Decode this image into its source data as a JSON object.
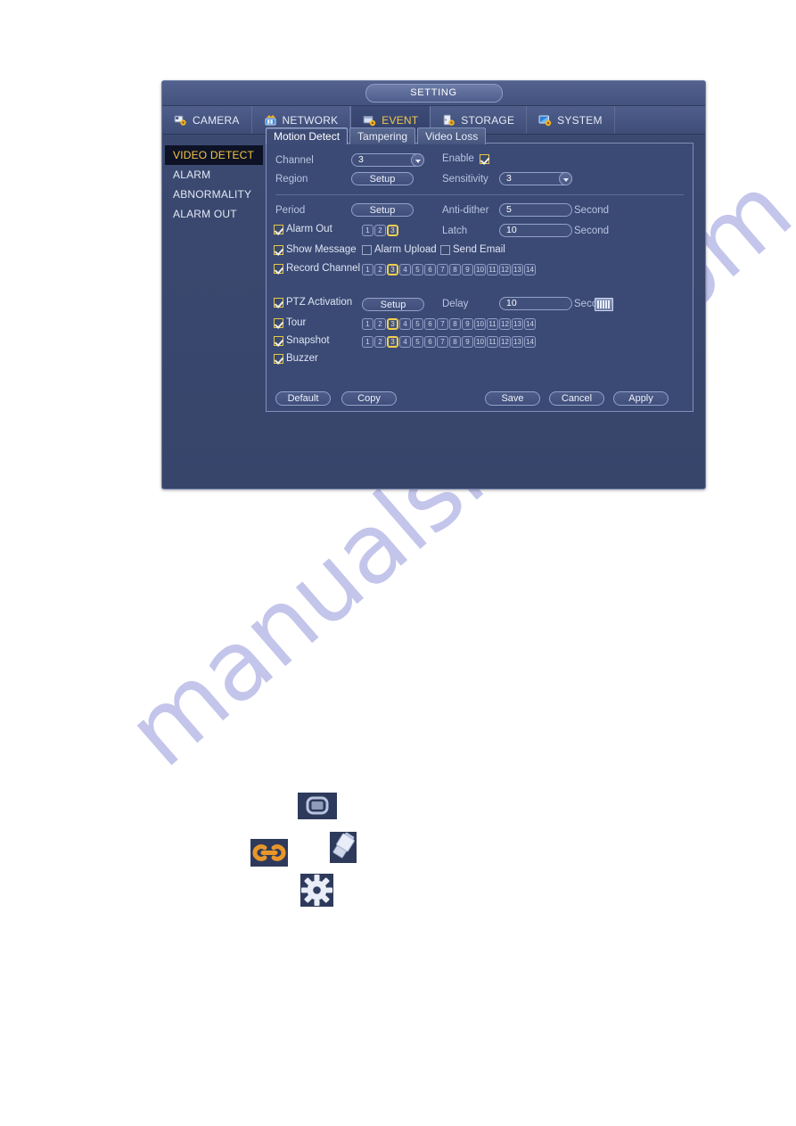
{
  "window": {
    "title": "SETTING",
    "menu": [
      {
        "label": "CAMERA",
        "icon": "camera-gear-icon",
        "active": false
      },
      {
        "label": "NETWORK",
        "icon": "network-icon",
        "active": false
      },
      {
        "label": "EVENT",
        "icon": "event-gear-icon",
        "active": true
      },
      {
        "label": "STORAGE",
        "icon": "storage-gear-icon",
        "active": false
      },
      {
        "label": "SYSTEM",
        "icon": "system-gear-icon",
        "active": false
      }
    ]
  },
  "sidebar": {
    "items": [
      {
        "label": "VIDEO DETECT",
        "active": true
      },
      {
        "label": "ALARM",
        "active": false
      },
      {
        "label": "ABNORMALITY",
        "active": false
      },
      {
        "label": "ALARM OUT",
        "active": false
      }
    ]
  },
  "tabs": [
    {
      "label": "Motion Detect",
      "active": true
    },
    {
      "label": "Tampering",
      "active": false
    },
    {
      "label": "Video Loss",
      "active": false
    }
  ],
  "form": {
    "channel_label": "Channel",
    "channel_value": "3",
    "enable_label": "Enable",
    "enable_checked": true,
    "region_label": "Region",
    "region_button": "Setup",
    "sensitivity_label": "Sensitivity",
    "sensitivity_value": "3",
    "period_label": "Period",
    "period_button": "Setup",
    "antidither_label": "Anti-dither",
    "antidither_value": "5",
    "antidither_unit": "Second",
    "alarmout_label": "Alarm Out",
    "alarmout_checked": true,
    "alarmout_channels": [
      "1",
      "2",
      "3"
    ],
    "alarmout_selected": [
      "3"
    ],
    "latch_label": "Latch",
    "latch_value": "10",
    "latch_unit": "Second",
    "showmessage_label": "Show Message",
    "showmessage_checked": true,
    "alarmupload_label": "Alarm Upload",
    "alarmupload_checked": false,
    "sendemail_label": "Send Email",
    "sendemail_checked": false,
    "recordchannel_label": "Record Channel",
    "recordchannel_checked": true,
    "ptz_label": "PTZ Activation",
    "ptz_checked": true,
    "ptz_button": "Setup",
    "delay_label": "Delay",
    "delay_value": "10",
    "delay_unit": "Second",
    "delay_icon": "keyboard-icon",
    "tour_label": "Tour",
    "tour_checked": true,
    "snapshot_label": "Snapshot",
    "snapshot_checked": true,
    "buzzer_label": "Buzzer",
    "buzzer_checked": true,
    "channels_14": [
      "1",
      "2",
      "3",
      "4",
      "5",
      "6",
      "7",
      "8",
      "9",
      "10",
      "11",
      "12",
      "13",
      "14"
    ],
    "channels_14_selected": [
      "3"
    ]
  },
  "buttons": {
    "default": "Default",
    "copy": "Copy",
    "save": "Save",
    "cancel": "Cancel",
    "apply": "Apply"
  },
  "icon_tiles": [
    {
      "name": "screen-icon"
    },
    {
      "name": "chain-link-icon"
    },
    {
      "name": "camera-icon"
    },
    {
      "name": "gear-icon"
    }
  ],
  "watermark": {
    "text": "manualshive.com"
  },
  "colors": {
    "accent_yellow": "#f5c842",
    "panel_blue": "#3b4a74",
    "window_blue": "#3c4a72",
    "chain_orange": "#e8962a"
  }
}
